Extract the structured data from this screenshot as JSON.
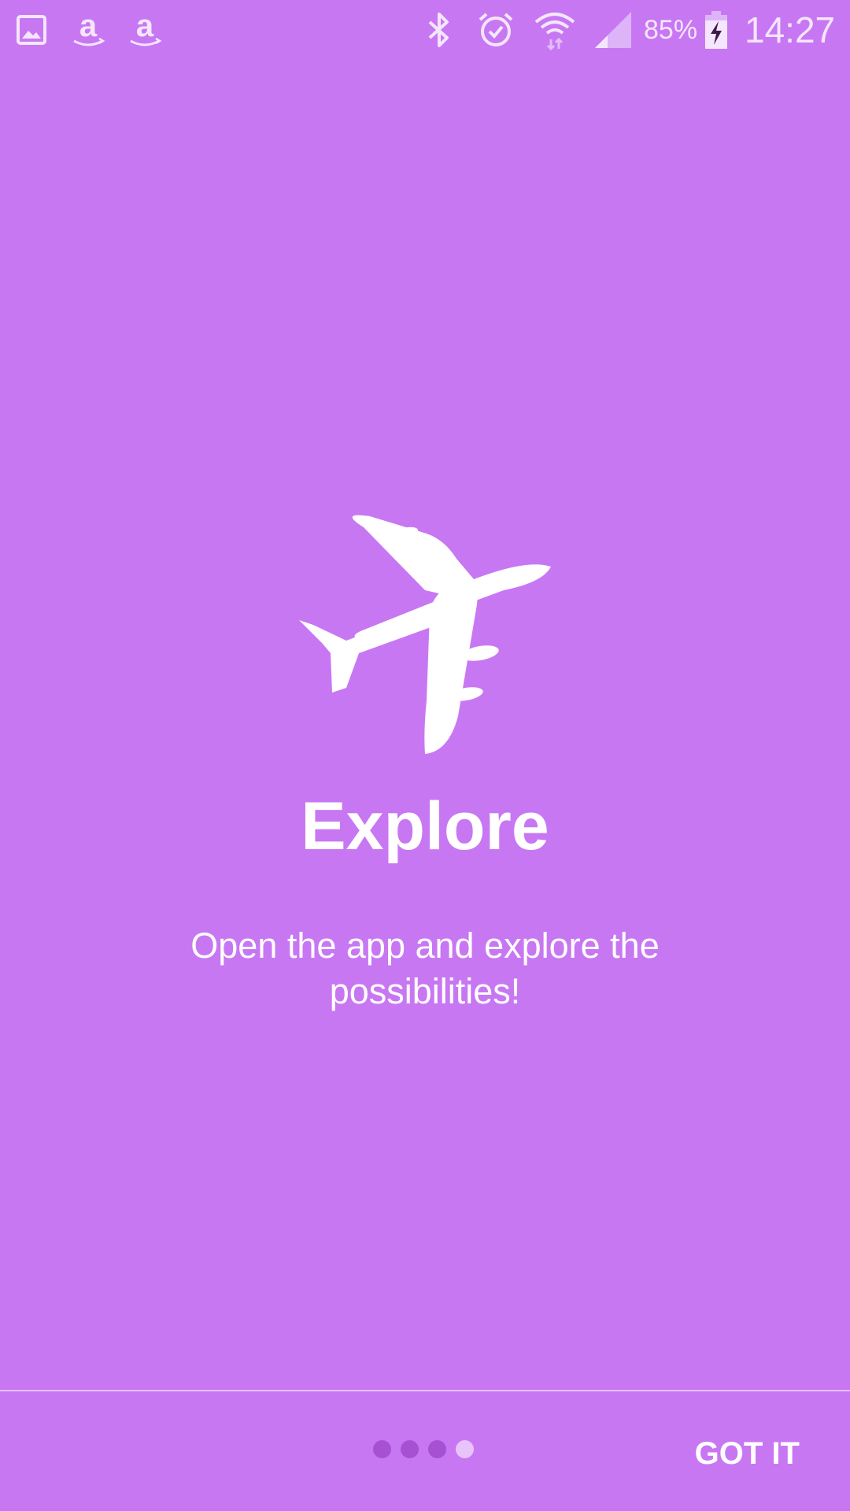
{
  "status_bar": {
    "icons_left": [
      "gallery-icon",
      "amazon-icon",
      "amazon-icon"
    ],
    "icons_right": [
      "bluetooth-icon",
      "alarm-icon",
      "wifi-icon",
      "signal-icon",
      "battery-charging-icon"
    ],
    "battery_percent": "85%",
    "time": "14:27"
  },
  "intro": {
    "icon": "airplane-icon",
    "title": "Explore",
    "description": "Open the app and explore the possibilities!"
  },
  "pager": {
    "total_pages": 4,
    "active_page": 4
  },
  "footer": {
    "got_it_label": "GOT IT"
  },
  "colors": {
    "background": "#C877F3",
    "dot_inactive": "#A551D2",
    "dot_active": "#E9C4FB",
    "text": "#FFFFFF"
  }
}
